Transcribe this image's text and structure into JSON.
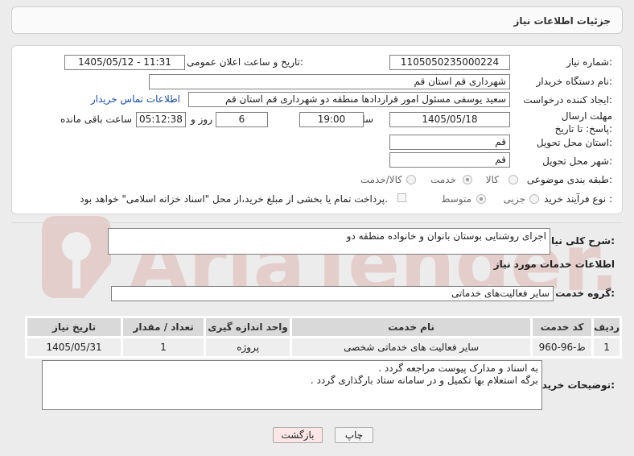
{
  "header": {
    "title": "جزئیات اطلاعات نیاز"
  },
  "form": {
    "need_number_label": "شماره نیاز:",
    "need_number": "1105050235000224",
    "announce_label": "تاریخ و ساعت اعلان عمومی:",
    "announce_value": "1405/05/12 - 11:31",
    "buyer_label": "نام دستگاه خریدار:",
    "buyer_value": "شهرداری قم استان قم",
    "creator_label": "ایجاد کننده درخواست:",
    "creator_value": "سعید یوسفی مسئول امور قراردادها منطقه دو شهرداری قم استان قم",
    "contact_link": "اطلاعات تماس خریدار",
    "deadline_label": "مهلت ارسال پاسخ: تا تاریخ:",
    "deadline_date": "1405/05/18",
    "time_label": "ساعت",
    "deadline_time": "19:00",
    "days_value": "6",
    "days_label": "روز و",
    "remaining_time": "05:12:38",
    "remaining_label": "ساعت باقی مانده",
    "province_label": "استان محل تحویل:",
    "province_value": "قم",
    "city_label": "شهر محل تحویل:",
    "city_value": "قم",
    "category_label": "طبقه بندی موضوعی:",
    "category_options": [
      "کالا",
      "خدمت",
      "کالا/خدمت"
    ],
    "category_selected": "خدمت",
    "process_label": "نوع فرآیند خرید :",
    "process_options": [
      "جزیی",
      "متوسط"
    ],
    "process_selected": "متوسط",
    "payment_text": "پرداخت تمام یا بخشی از مبلغ خرید،از محل \"اسناد خزانه اسلامی\" خواهد بود."
  },
  "summary": {
    "label": "شرح کلی نیاز:",
    "value": "اجرای روشنایی بوستان بانوان و خانواده منطقه دو"
  },
  "services": {
    "section_title": "اطلاعات خدمات مورد نیاز",
    "group_label": "گروه خدمت:",
    "group_value": "سایر فعالیت‌های خدماتی",
    "table": {
      "headers": [
        "ردیف",
        "کد خدمت",
        "نام خدمت",
        "واحد اندازه گیری",
        "تعداد / مقدار",
        "تاریخ نیاز"
      ],
      "rows": [
        [
          "1",
          "ط-96-960",
          "سایر فعالیت های خدماتی شخصی",
          "پروژه",
          "1",
          "1405/05/31"
        ]
      ]
    }
  },
  "notes": {
    "label": "توضیحات خریدار:",
    "line1": "به اسناد و مدارک پیوست مراجعه گردد .",
    "line2": "برگه استعلام بها تکمیل و در سامانه ستاد بارگذاری گردد ."
  },
  "buttons": {
    "print": "چاپ",
    "back": "بازگشت"
  },
  "watermark": {
    "text": "AriaTender.neT"
  },
  "colors": {
    "link": "#1a4fa3",
    "back_button_bg": "#fde6e6",
    "watermark": "#c0392b"
  }
}
